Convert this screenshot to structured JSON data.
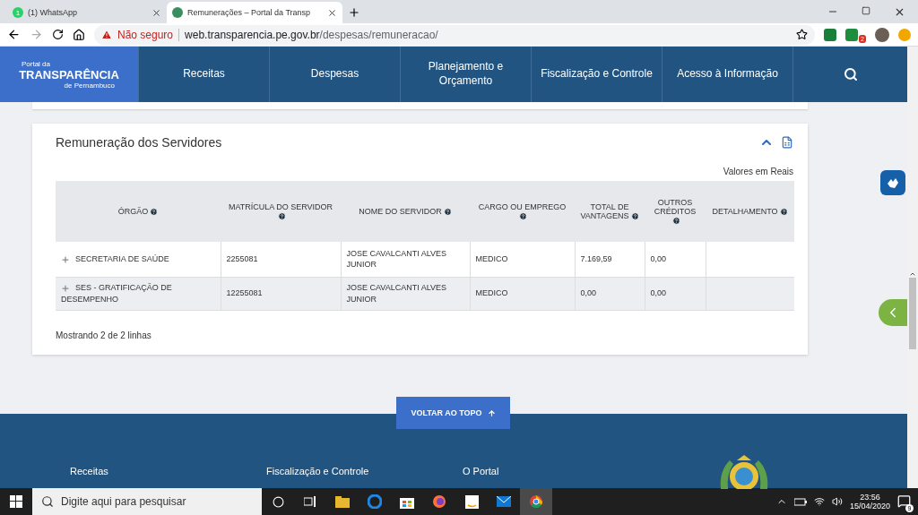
{
  "browser": {
    "tabs": [
      {
        "title": "(1) WhatsApp",
        "badge": "1",
        "selected": false
      },
      {
        "title": "Remunerações – Portal da Transp",
        "selected": true
      }
    ],
    "address": {
      "security": "Não seguro",
      "host": "web.transparencia.pe.gov.br",
      "path": "/despesas/remuneracao/"
    },
    "extension_badge": "2"
  },
  "site_nav": {
    "logo": {
      "top": "Portal da",
      "main": "TRANSPARÊNCIA",
      "bottom": "de Pernambuco"
    },
    "items": [
      "Receitas",
      "Despesas",
      "Planejamento e Orçamento",
      "Fiscalização e Controle",
      "Acesso à Informação"
    ]
  },
  "panel": {
    "title": "Remuneração dos Servidores",
    "units": "Valores em Reais",
    "columns": [
      {
        "label": "ÓRGÃO",
        "help": true
      },
      {
        "label": "MATRÍCULA DO SERVIDOR",
        "help": true
      },
      {
        "label": "NOME DO SERVIDOR",
        "help": true
      },
      {
        "label": "CARGO OU EMPREGO",
        "help": true
      },
      {
        "label": "TOTAL DE VANTAGENS",
        "help": true
      },
      {
        "label": "OUTROS CRÉDITOS",
        "help": true
      },
      {
        "label": "DETALHAMENTO",
        "help": true
      }
    ],
    "rows": [
      {
        "cells": [
          "SECRETARIA DE SAÚDE",
          "2255081",
          "JOSE CAVALCANTI ALVES JUNIOR",
          "MEDICO",
          "7.169,59",
          "0,00",
          ""
        ],
        "expanded": false
      },
      {
        "cells": [
          "SES - GRATIFICAÇÃO DE DESEMPENHO",
          "12255081",
          "JOSE CAVALCANTI ALVES JUNIOR",
          "MEDICO",
          "0,00",
          "0,00",
          ""
        ],
        "expanded": false
      }
    ],
    "summary": "Mostrando 2 de 2 linhas"
  },
  "back_to_top": "VOLTAR AO TOPO",
  "footer": {
    "links": [
      "Receitas",
      "Fiscalização e Controle",
      "O Portal"
    ]
  },
  "taskbar": {
    "search_placeholder": "Digite aqui para pesquisar",
    "time": "23:56",
    "date": "15/04/2020",
    "notifications": "9"
  }
}
